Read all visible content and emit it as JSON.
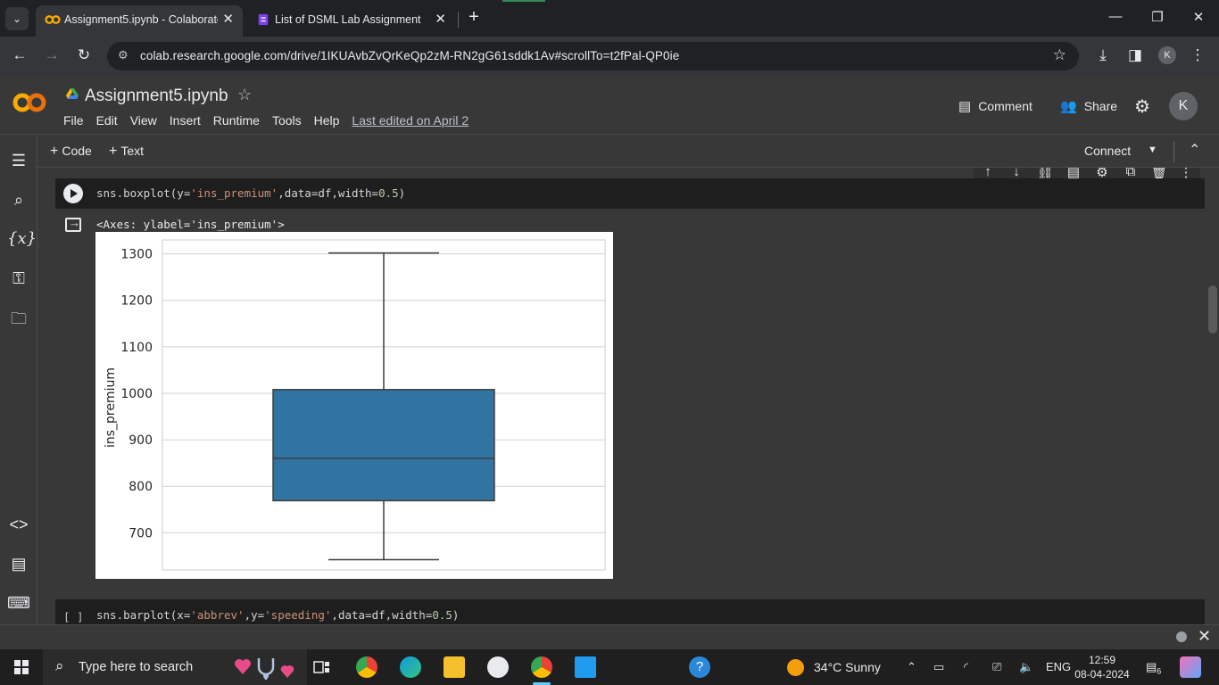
{
  "browser": {
    "tabs": [
      {
        "title": "Assignment5.ipynb - Colaborato",
        "active": true
      },
      {
        "title": "List of DSML Lab Assignment",
        "active": false
      }
    ],
    "url": "colab.research.google.com/drive/1IKUAvbZvQrKeQp2zM-RN2gG61sddk1Av#scrollTo=t2fPal-QP0ie",
    "profile_initial": "K"
  },
  "colab": {
    "logo": "CO",
    "notebook_title": "Assignment5.ipynb",
    "menu": [
      "File",
      "Edit",
      "View",
      "Insert",
      "Runtime",
      "Tools",
      "Help"
    ],
    "last_edited": "Last edited on April 2",
    "comment_label": "Comment",
    "share_label": "Share",
    "avatar_initial": "K",
    "toolbar": {
      "code_label": "Code",
      "text_label": "Text",
      "connect_label": "Connect"
    }
  },
  "cells": {
    "cell1_code": {
      "prefix": "sns.boxplot(y=",
      "str1": "'ins_premium'",
      "mid": ",data=df,width=",
      "num": "0.5",
      "suffix": ")"
    },
    "cell1_output": "<Axes: ylabel='ins_premium'>",
    "cell2_bracket": "[ ]",
    "cell2_code": {
      "prefix": "sns.barplot(x=",
      "str1": "'abbrev'",
      "mid1": ",y=",
      "str2": "'speeding'",
      "mid2": ",data=df,width=",
      "num": "0.5",
      "suffix": ")"
    }
  },
  "chart_data": {
    "type": "box",
    "ylabel": "ins_premium",
    "ylim": [
      620,
      1330
    ],
    "yticks": [
      700,
      800,
      900,
      1000,
      1100,
      1200,
      1300
    ],
    "grid": true,
    "box": {
      "whisker_low": 642,
      "q1": 769,
      "median": 860,
      "q3": 1008,
      "whisker_high": 1302
    },
    "box_color": "#3274a1"
  },
  "taskbar": {
    "search_placeholder": "Type here to search",
    "weather": "34°C  Sunny",
    "language": "ENG",
    "time": "12:59",
    "date": "08-04-2024",
    "notification_count": "6"
  }
}
